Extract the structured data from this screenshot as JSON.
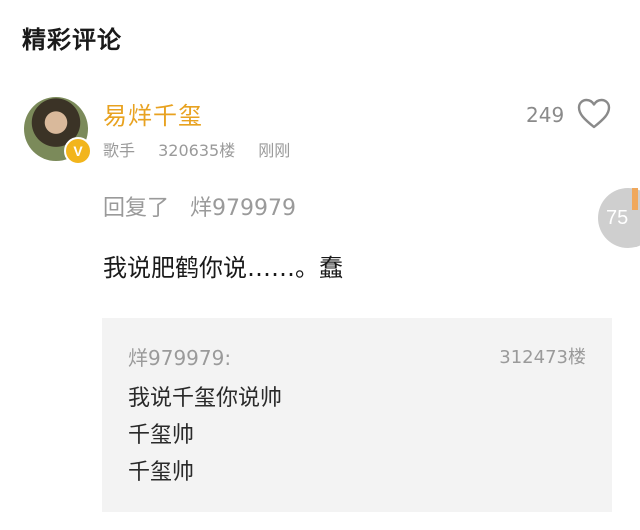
{
  "section": {
    "title": "精彩评论"
  },
  "comment": {
    "username": "易烊千玺",
    "verified_badge": "V",
    "role": "歌手",
    "floor": "320635楼",
    "time": "刚刚",
    "likes": "249",
    "reply_prefix": "回复了",
    "reply_to_user": "烊979979",
    "text": "我说肥鹤你说……。蠢"
  },
  "floating": {
    "count": "75"
  },
  "quoted": {
    "user": "烊979979:",
    "floor": "312473楼",
    "lines": [
      "我说千玺你说帅",
      "千玺帅",
      "千玺帅"
    ]
  },
  "colors": {
    "username": "#e8a220",
    "badge": "#f2b51c",
    "meta": "#9a9a9a",
    "quote_bg": "#f3f3f3"
  },
  "icons": {
    "like": "heart-outline-icon",
    "verified": "verified-v-badge-icon"
  }
}
